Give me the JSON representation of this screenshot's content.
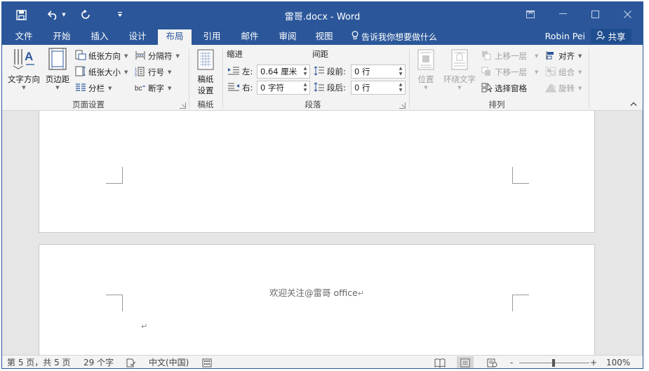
{
  "window": {
    "title": "雷哥.docx - Word",
    "quick_access": {
      "save": "save-icon",
      "undo": "undo-icon",
      "redo": "redo-icon",
      "customize": "customize-icon"
    }
  },
  "tabs": [
    "文件",
    "开始",
    "插入",
    "设计",
    "布局",
    "引用",
    "邮件",
    "审阅",
    "视图"
  ],
  "active_tab": "布局",
  "tell_me": "告诉我你想要做什么",
  "user": "Robin Pei",
  "share": "共享",
  "ribbon": {
    "page_setup": {
      "label": "页面设置",
      "text_direction": "文字方向",
      "margins": "页边距",
      "orientation": "纸张方向",
      "size": "纸张大小",
      "columns": "分栏",
      "breaks": "分隔符",
      "line_numbers": "行号",
      "hyphenation": "断字"
    },
    "manuscript": {
      "label": "稿纸",
      "button_line1": "稿纸",
      "button_line2": "设置"
    },
    "paragraph": {
      "label": "段落",
      "indent_title": "缩进",
      "spacing_title": "间距",
      "left_label": "左:",
      "left_value": "0.64 厘米",
      "right_label": "右:",
      "right_value": "0 字符",
      "before_label": "段前:",
      "before_value": "0 行",
      "after_label": "段后:",
      "after_value": "0 行"
    },
    "arrange": {
      "label": "排列",
      "position": "位置",
      "wrap_text": "环绕文字",
      "bring_forward": "上移一层",
      "send_backward": "下移一层",
      "selection_pane": "选择窗格",
      "align": "对齐",
      "group": "组合",
      "rotate": "旋转"
    }
  },
  "document": {
    "header_text": "欢迎关注@雷哥 office",
    "paragraph_mark": "↵"
  },
  "statusbar": {
    "page_info": "第 5 页，共 5 页",
    "word_count": "29 个字",
    "language": "中文(中国)",
    "zoom": "100%",
    "zoom_minus": "-",
    "zoom_plus": "+"
  },
  "colors": {
    "accent": "#2b579a",
    "ribbon_bg": "#f3f3f3",
    "doc_bg": "#e6e6e6"
  }
}
